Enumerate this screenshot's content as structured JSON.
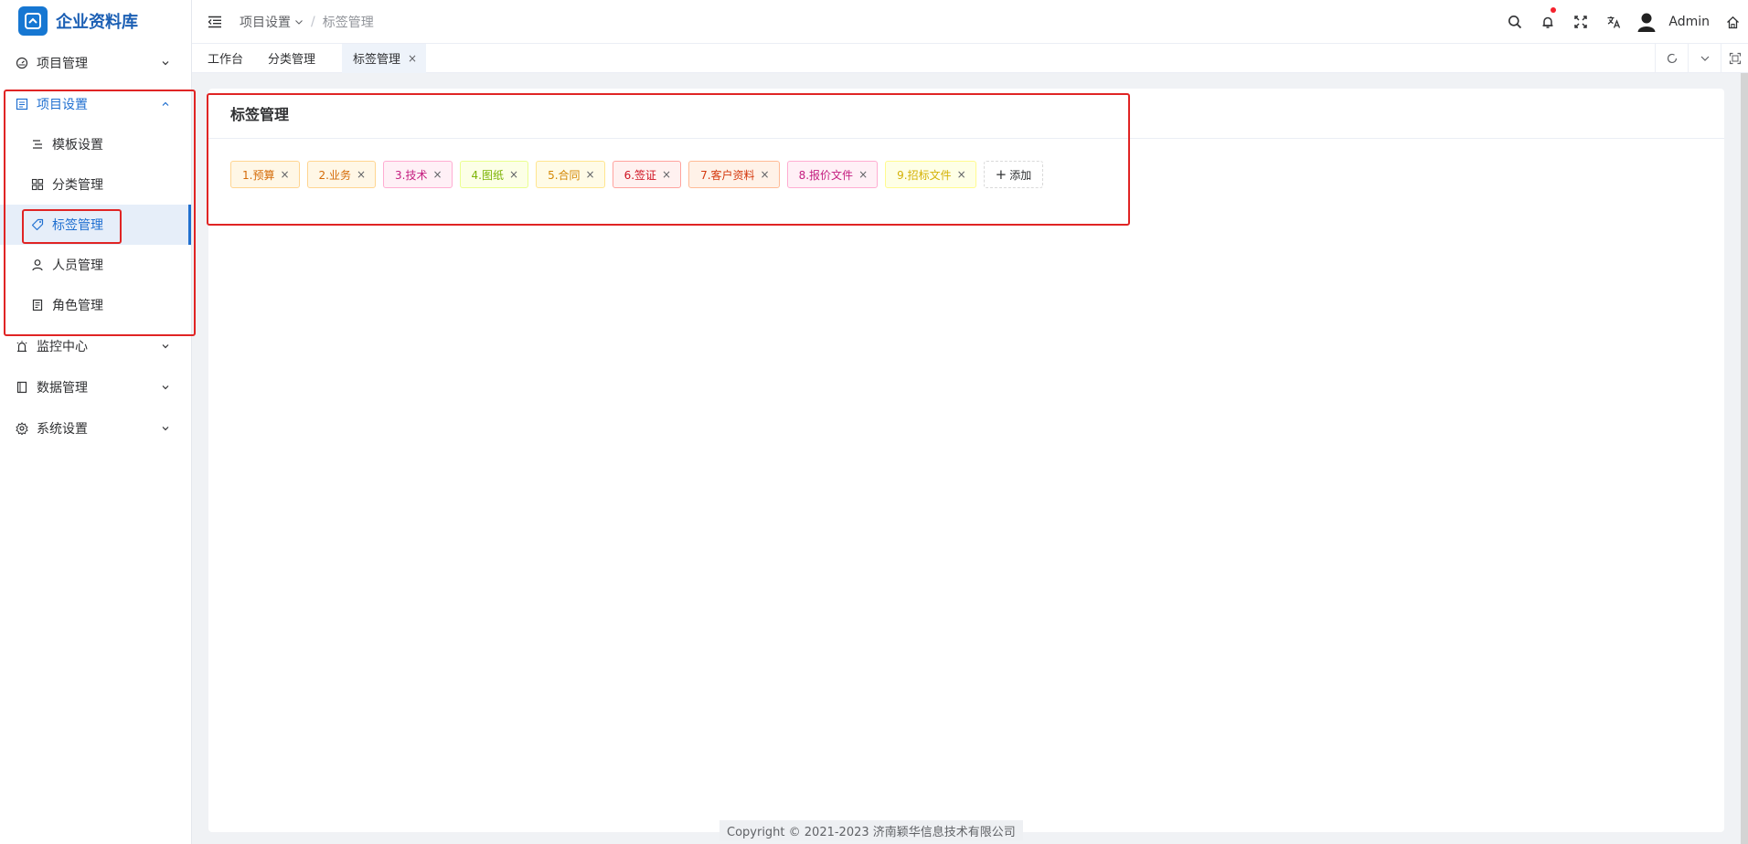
{
  "app": {
    "title": "企业资料库"
  },
  "sidebar": {
    "menu": [
      {
        "label": "项目管理",
        "icon": "dashboard-icon"
      },
      {
        "label": "项目设置",
        "icon": "list-icon",
        "open": true,
        "children": [
          {
            "label": "模板设置",
            "icon": "align-icon"
          },
          {
            "label": "分类管理",
            "icon": "grid-icon"
          },
          {
            "label": "标签管理",
            "icon": "tag-icon",
            "active": true
          },
          {
            "label": "人员管理",
            "icon": "user-icon"
          },
          {
            "label": "角色管理",
            "icon": "document-icon"
          }
        ]
      },
      {
        "label": "监控中心",
        "icon": "alarm-icon"
      },
      {
        "label": "数据管理",
        "icon": "book-icon"
      },
      {
        "label": "系统设置",
        "icon": "gear-icon"
      }
    ]
  },
  "header": {
    "breadcrumb": {
      "parent": "项目设置",
      "separator": "/",
      "current": "标签管理"
    },
    "user": {
      "name": "Admin"
    }
  },
  "tabs": [
    {
      "label": "工作台"
    },
    {
      "label": "分类管理"
    },
    {
      "label": "标签管理",
      "active": true,
      "close": "×"
    }
  ],
  "content": {
    "title": "标签管理",
    "tags": [
      {
        "label": "1.预算",
        "color": "#d46b08",
        "bg": "#fff7e6",
        "border": "#ffd591"
      },
      {
        "label": "2.业务",
        "color": "#d46b08",
        "bg": "#fff7e6",
        "border": "#ffd591"
      },
      {
        "label": "3.技术",
        "color": "#c41d7f",
        "bg": "#fff0f6",
        "border": "#ffadd2"
      },
      {
        "label": "4.图纸",
        "color": "#7cb305",
        "bg": "#fcffe6",
        "border": "#eaff8f"
      },
      {
        "label": "5.合同",
        "color": "#d48806",
        "bg": "#fffbe6",
        "border": "#ffe58f"
      },
      {
        "label": "6.签证",
        "color": "#cf1322",
        "bg": "#fff1f0",
        "border": "#ffa39e"
      },
      {
        "label": "7.客户资料",
        "color": "#d4380d",
        "bg": "#fff2e8",
        "border": "#ffbb96"
      },
      {
        "label": "8.报价文件",
        "color": "#c41d7f",
        "bg": "#fff0f6",
        "border": "#ffadd2"
      },
      {
        "label": "9.招标文件",
        "color": "#d4b106",
        "bg": "#feffe6",
        "border": "#fffb8f"
      }
    ],
    "tag_close": "×",
    "add_label": "添加",
    "add_icon": "+"
  },
  "footer": {
    "text": "Copyright © 2021-2023 济南颖华信息技术有限公司"
  },
  "colors": {
    "accent": "#1f6fd0",
    "highlight": "#e02424",
    "notify_dot": "#f5222d"
  }
}
